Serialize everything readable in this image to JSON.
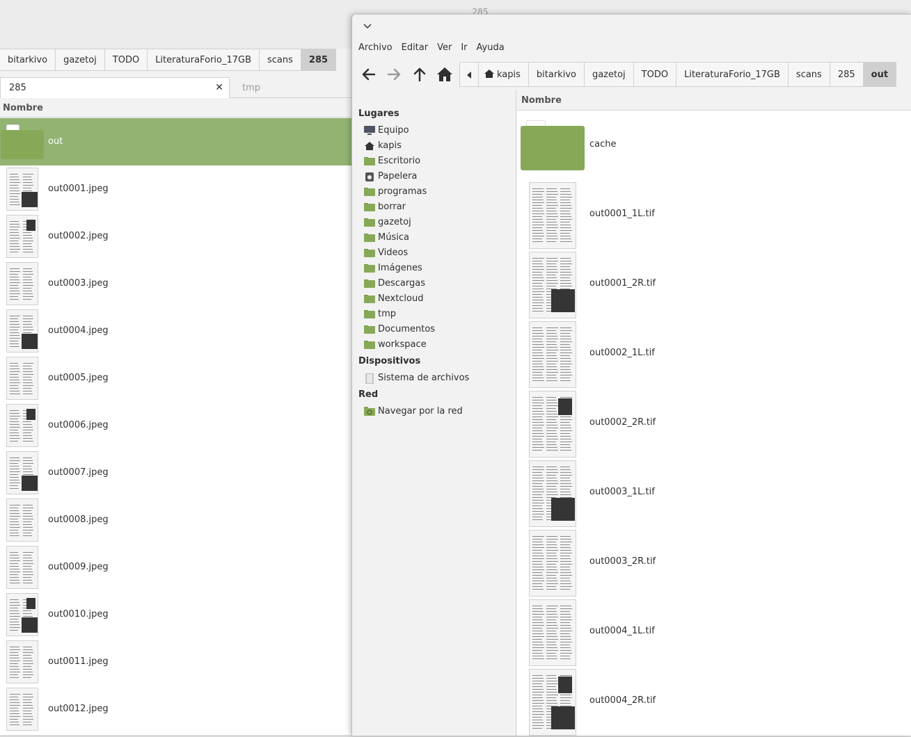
{
  "back_window": {
    "title": "285",
    "breadcrumbs": [
      "bitarkivo",
      "gazetoj",
      "TODO",
      "LiteraturaForio_17GB",
      "scans",
      "285"
    ],
    "active_crumb": "285",
    "tabs": [
      {
        "label": "285",
        "close": "✕"
      },
      {
        "label": "tmp"
      }
    ],
    "column_header": "Nombre",
    "files": [
      "out",
      "out0001.jpeg",
      "out0002.jpeg",
      "out0003.jpeg",
      "out0004.jpeg",
      "out0005.jpeg",
      "out0006.jpeg",
      "out0007.jpeg",
      "out0008.jpeg",
      "out0009.jpeg",
      "out0010.jpeg",
      "out0011.jpeg",
      "out0012.jpeg"
    ],
    "selected": "out"
  },
  "front_window": {
    "menu": [
      "Archivo",
      "Editar",
      "Ver",
      "Ir",
      "Ayuda"
    ],
    "toolbar": [
      "back-icon",
      "forward-icon",
      "up-icon",
      "home-icon"
    ],
    "breadcrumbs": [
      "kapis",
      "bitarkivo",
      "gazetoj",
      "TODO",
      "LiteraturaForio_17GB",
      "scans",
      "285",
      "out"
    ],
    "active_crumb": "out",
    "sidebar": {
      "places_header": "Lugares",
      "places": [
        "Equipo",
        "kapis",
        "Escritorio",
        "Papelera",
        "programas",
        "borrar",
        "gazetoj",
        "Música",
        "Videos",
        "Imágenes",
        "Descargas",
        "Nextcloud",
        "tmp",
        "Documentos",
        "workspace"
      ],
      "devices_header": "Dispositivos",
      "devices": [
        "Sistema de archivos"
      ],
      "network_header": "Red",
      "network": [
        "Navegar por la red"
      ]
    },
    "column_header": "Nombre",
    "files": [
      "cache",
      "out0001_1L.tif",
      "out0001_2R.tif",
      "out0002_1L.tif",
      "out0002_2R.tif",
      "out0003_1L.tif",
      "out0003_2R.tif",
      "out0004_1L.tif",
      "out0004_2R.tif"
    ]
  },
  "colors": {
    "folder": "#87a957",
    "folder_tab": "#ffffff",
    "selection": "#92b372",
    "path_active": "#cfcfcf"
  }
}
